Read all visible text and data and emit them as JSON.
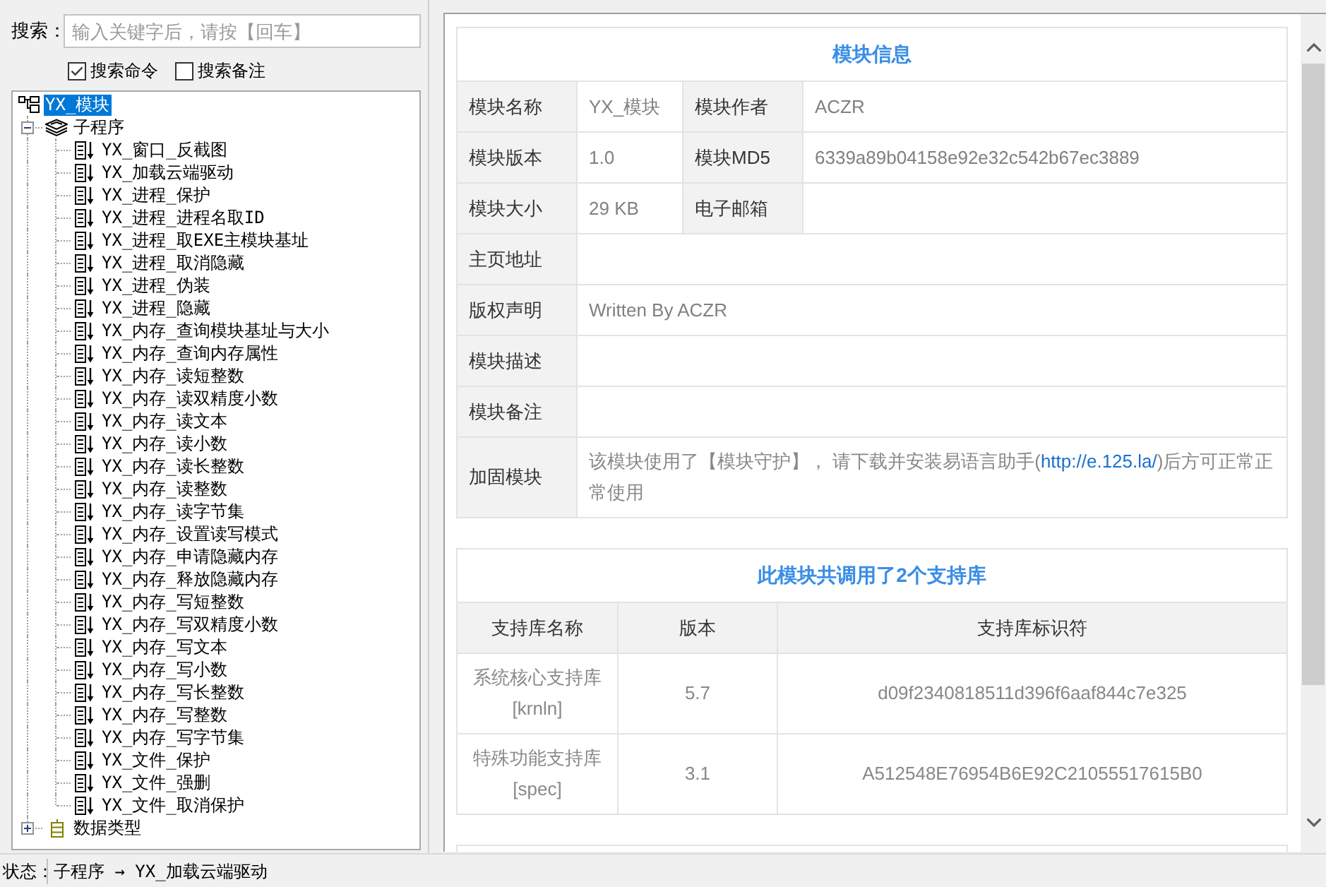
{
  "search": {
    "label": "搜索：",
    "placeholder": "输入关键字后，请按【回车】"
  },
  "search_options": [
    {
      "label": "搜索命令",
      "checked": true
    },
    {
      "label": "搜索备注",
      "checked": false
    }
  ],
  "tree": [
    {
      "label": "YX_模块",
      "kind": "module",
      "selected": true,
      "children": [
        {
          "label": "子程序",
          "kind": "folder",
          "selected": false,
          "expanded": true,
          "children": [
            {
              "label": "YX_窗口_反截图",
              "kind": "function",
              "selected": false
            },
            {
              "label": "YX_加载云端驱动",
              "kind": "function",
              "selected": false
            },
            {
              "label": "YX_进程_保护",
              "kind": "function",
              "selected": false
            },
            {
              "label": "YX_进程_进程名取ID",
              "kind": "function",
              "selected": false
            },
            {
              "label": "YX_进程_取EXE主模块基址",
              "kind": "function",
              "selected": false
            },
            {
              "label": "YX_进程_取消隐藏",
              "kind": "function",
              "selected": false
            },
            {
              "label": "YX_进程_伪装",
              "kind": "function",
              "selected": false
            },
            {
              "label": "YX_进程_隐藏",
              "kind": "function",
              "selected": false
            },
            {
              "label": "YX_内存_查询模块基址与大小",
              "kind": "function",
              "selected": false
            },
            {
              "label": "YX_内存_查询内存属性",
              "kind": "function",
              "selected": false
            },
            {
              "label": "YX_内存_读短整数",
              "kind": "function",
              "selected": false
            },
            {
              "label": "YX_内存_读双精度小数",
              "kind": "function",
              "selected": false
            },
            {
              "label": "YX_内存_读文本",
              "kind": "function",
              "selected": false
            },
            {
              "label": "YX_内存_读小数",
              "kind": "function",
              "selected": false
            },
            {
              "label": "YX_内存_读长整数",
              "kind": "function",
              "selected": false
            },
            {
              "label": "YX_内存_读整数",
              "kind": "function",
              "selected": false
            },
            {
              "label": "YX_内存_读字节集",
              "kind": "function",
              "selected": false
            },
            {
              "label": "YX_内存_设置读写模式",
              "kind": "function",
              "selected": false
            },
            {
              "label": "YX_内存_申请隐藏内存",
              "kind": "function",
              "selected": false
            },
            {
              "label": "YX_内存_释放隐藏内存",
              "kind": "function",
              "selected": false
            },
            {
              "label": "YX_内存_写短整数",
              "kind": "function",
              "selected": false
            },
            {
              "label": "YX_内存_写双精度小数",
              "kind": "function",
              "selected": false
            },
            {
              "label": "YX_内存_写文本",
              "kind": "function",
              "selected": false
            },
            {
              "label": "YX_内存_写小数",
              "kind": "function",
              "selected": false
            },
            {
              "label": "YX_内存_写长整数",
              "kind": "function",
              "selected": false
            },
            {
              "label": "YX_内存_写整数",
              "kind": "function",
              "selected": false
            },
            {
              "label": "YX_内存_写字节集",
              "kind": "function",
              "selected": false
            },
            {
              "label": "YX_文件_保护",
              "kind": "function",
              "selected": false
            },
            {
              "label": "YX_文件_强删",
              "kind": "function",
              "selected": false
            },
            {
              "label": "YX_文件_取消保护",
              "kind": "function",
              "selected": false
            }
          ]
        },
        {
          "label": "数据类型",
          "kind": "types",
          "selected": false,
          "expanded": false
        }
      ]
    }
  ],
  "module_info": {
    "title": "模块信息",
    "rows": [
      [
        {
          "label": "模块名称",
          "value": "YX_模块"
        },
        {
          "label": "模块作者",
          "value": "ACZR"
        }
      ],
      [
        {
          "label": "模块版本",
          "value": "1.0"
        },
        {
          "label": "模块MD5",
          "value": "6339a89b04158e92e32c542b67ec3889"
        }
      ],
      [
        {
          "label": "模块大小",
          "value": "29 KB"
        },
        {
          "label": "电子邮箱"
        }
      ],
      [
        {
          "label": "主页地址"
        }
      ],
      [
        {
          "label": "版权声明",
          "value": "Written By ACZR"
        }
      ],
      [
        {
          "label": "模块描述"
        }
      ],
      [
        {
          "label": "模块备注"
        }
      ],
      [
        {
          "label": "加固模块",
          "note": {
            "before": "该模块使用了【模块守护】， 请下载并安装易语言助手(",
            "link": "http://e.125.la/",
            "after": ")后方可正常正常使用"
          }
        }
      ]
    ]
  },
  "libraries": {
    "title": "此模块共调用了2个支持库",
    "columns": [
      "支持库名称",
      "版本",
      "支持库标识符"
    ],
    "rows": [
      {
        "name": "系统核心支持库",
        "short_name": "[krnln]",
        "version": "5.7",
        "id": "d09f2340818511d396f6aaf844c7e325"
      },
      {
        "name": "特殊功能支持库",
        "short_name": "[spec]",
        "version": "3.1",
        "id": "A512548E76954B6E92C21055517615B0"
      }
    ]
  },
  "status_bar": {
    "label": "状态：",
    "text": "子程序 → YX_加载云端驱动"
  }
}
